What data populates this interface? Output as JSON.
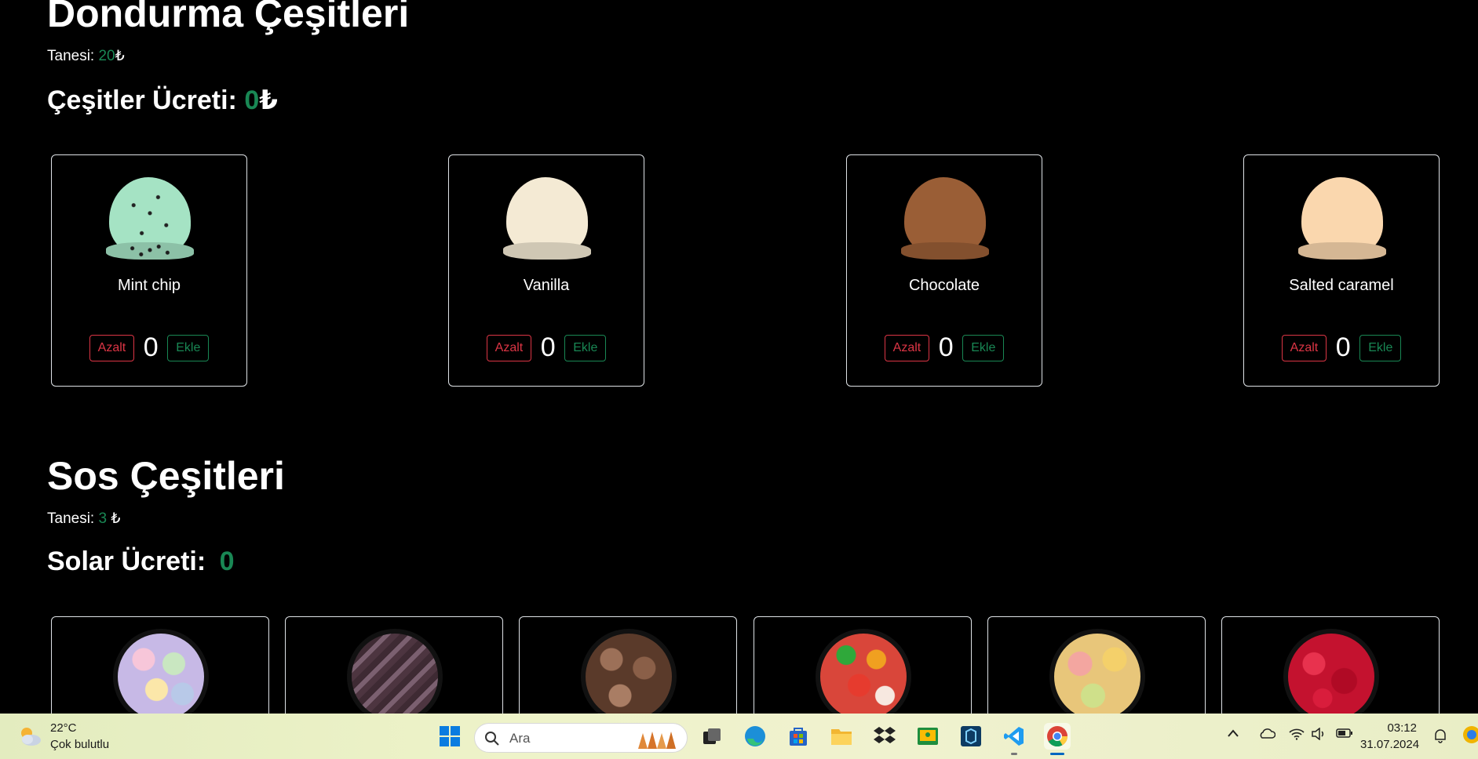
{
  "ice_cream": {
    "title": "Dondurma Çeşitleri",
    "unit_label": "Tanesi:",
    "unit_price": "20",
    "currency": "₺",
    "fee_label": "Çeşitler Ücreti:",
    "fee_value": "0",
    "flavors": [
      {
        "name": "Mint chip",
        "count": "0",
        "color": "#a5e3c4"
      },
      {
        "name": "Vanilla",
        "count": "0",
        "color": "#f4ead4"
      },
      {
        "name": "Chocolate",
        "count": "0",
        "color": "#9a5e36"
      },
      {
        "name": "Salted caramel",
        "count": "0",
        "color": "#fad7ae"
      }
    ],
    "decrease_label": "Azalt",
    "increase_label": "Ekle"
  },
  "sauces": {
    "title": "Sos Çeşitleri",
    "unit_label": "Tanesi:",
    "unit_price": "3",
    "currency": "₺",
    "fee_label": "Solar Ücreti:",
    "fee_value": "0",
    "items": [
      {
        "icon": "candy-pastel-image",
        "color": "#b8c9e8"
      },
      {
        "icon": "chocolate-swirl-image",
        "color": "#5a4150"
      },
      {
        "icon": "chocolate-drops-image",
        "color": "#6b4a38"
      },
      {
        "icon": "gummy-bears-image",
        "color": "#d9463a"
      },
      {
        "icon": "jelly-candy-image",
        "color": "#e8c67a"
      },
      {
        "icon": "red-cherries-image",
        "color": "#c4122f"
      }
    ]
  },
  "colors": {
    "green": "#198754",
    "red": "#dc3545",
    "taskbar_accent": "#0067c0"
  },
  "taskbar": {
    "weather_temp": "22°C",
    "weather_desc": "Çok bulutlu",
    "search_placeholder": "Ara",
    "time": "03:12",
    "date": "31.07.2024"
  }
}
